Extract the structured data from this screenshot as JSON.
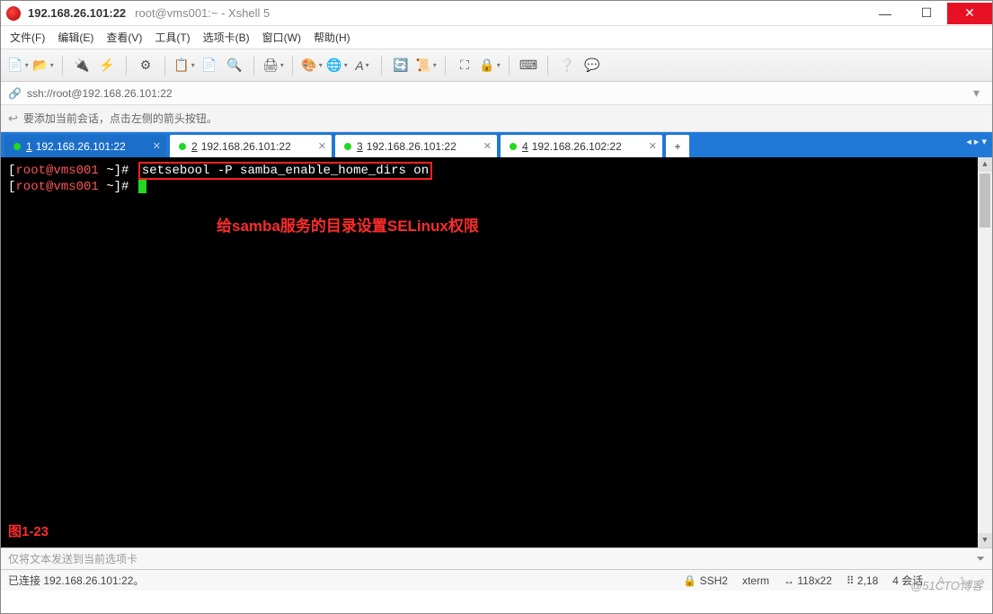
{
  "window": {
    "title_bold": "192.168.26.101:22",
    "title_sub": "root@vms001:~ - Xshell 5"
  },
  "menu": {
    "file": "文件(F)",
    "edit": "编辑(E)",
    "view": "查看(V)",
    "tools": "工具(T)",
    "tab": "选项卡(B)",
    "window": "窗口(W)",
    "help": "帮助(H)"
  },
  "address": {
    "url": "ssh://root@192.168.26.101:22"
  },
  "hint": {
    "text": "要添加当前会话，点击左侧的箭头按钮。"
  },
  "tabs": [
    {
      "n": "1",
      "label": "192.168.26.101:22",
      "dot": "#22d922",
      "active": true
    },
    {
      "n": "2",
      "label": "192.168.26.101:22",
      "dot": "#22d922",
      "active": false
    },
    {
      "n": "3",
      "label": "192.168.26.101:22",
      "dot": "#22d922",
      "active": false
    },
    {
      "n": "4",
      "label": "192.168.26.102:22",
      "dot": "#22d922",
      "active": false
    }
  ],
  "terminal": {
    "line1_prompt": "[root@vms001 ~]#",
    "line1_cmd": "setsebool -P samba_enable_home_dirs on",
    "line2_prompt": "[root@vms001 ~]#",
    "annotation": "给samba服务的目录设置SELinux权限",
    "figure": "图1-23"
  },
  "inputbar": {
    "placeholder": "仅将文本发送到当前选项卡"
  },
  "status": {
    "left": "已连接 192.168.26.101:22。",
    "ssh": "SSH2",
    "term": "xterm",
    "size": "118x22",
    "pos": "2,18",
    "sessions": "4 会话"
  },
  "watermark": "@51CTO博客"
}
